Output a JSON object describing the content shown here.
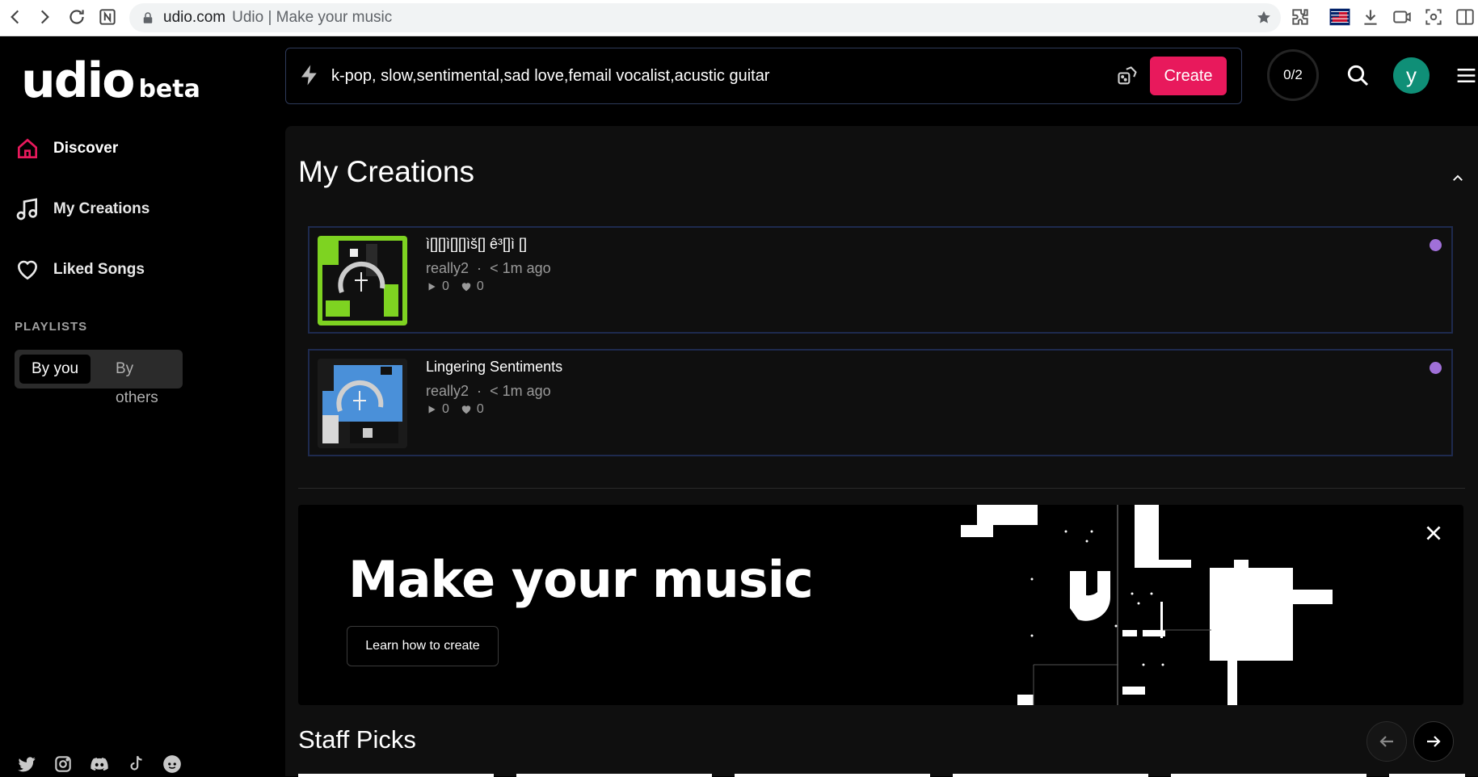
{
  "browser": {
    "domain": "udio.com",
    "page_title": "Udio | Make your music",
    "icons": [
      "back-icon",
      "forward-icon",
      "reload-icon",
      "notion-icon",
      "lock-icon",
      "bookmark-star-icon",
      "extension-icon",
      "flag-icon",
      "download-icon",
      "cast-icon",
      "screenshot-icon",
      "split-view-icon"
    ]
  },
  "sidebar": {
    "logo": "udio",
    "logo_badge": "beta",
    "nav": [
      {
        "label": "Discover",
        "icon": "home-icon",
        "active": true
      },
      {
        "label": "My Creations",
        "icon": "music-note-icon",
        "active": false
      },
      {
        "label": "Liked Songs",
        "icon": "heart-icon",
        "active": false
      }
    ],
    "playlists_heading": "PLAYLISTS",
    "playlist_tabs": {
      "selected": "By you",
      "other": "By others"
    },
    "socials": [
      "twitter-icon",
      "instagram-icon",
      "discord-icon",
      "tiktok-icon",
      "reddit-icon"
    ]
  },
  "topbar": {
    "prompt": "k-pop, slow,sentimental,sad love,femail vocalist,acustic guitar",
    "create_label": "Create",
    "credits": "0/2",
    "avatar_letter": "y"
  },
  "main": {
    "section_title": "My Creations",
    "creations": [
      {
        "title": "ì[][]ì[][]ìš[] ê³[]ì []",
        "author": "really2",
        "time": "< 1m ago",
        "plays": "0",
        "likes": "0",
        "thumb_accent": "#7ed321",
        "status_color": "#a070d8"
      },
      {
        "title": "Lingering Sentiments",
        "author": "really2",
        "time": "< 1m ago",
        "plays": "0",
        "likes": "0",
        "thumb_accent": "#4a90d9",
        "status_color": "#a070d8"
      }
    ],
    "banner": {
      "headline": "Make your music",
      "button_label": "Learn how to create"
    },
    "staff_picks_title": "Staff Picks"
  },
  "colors": {
    "brand_pink": "#e8195c",
    "avatar_teal": "#0f8f77",
    "card_border": "#1e2a4e",
    "status_purple": "#a070d8"
  }
}
